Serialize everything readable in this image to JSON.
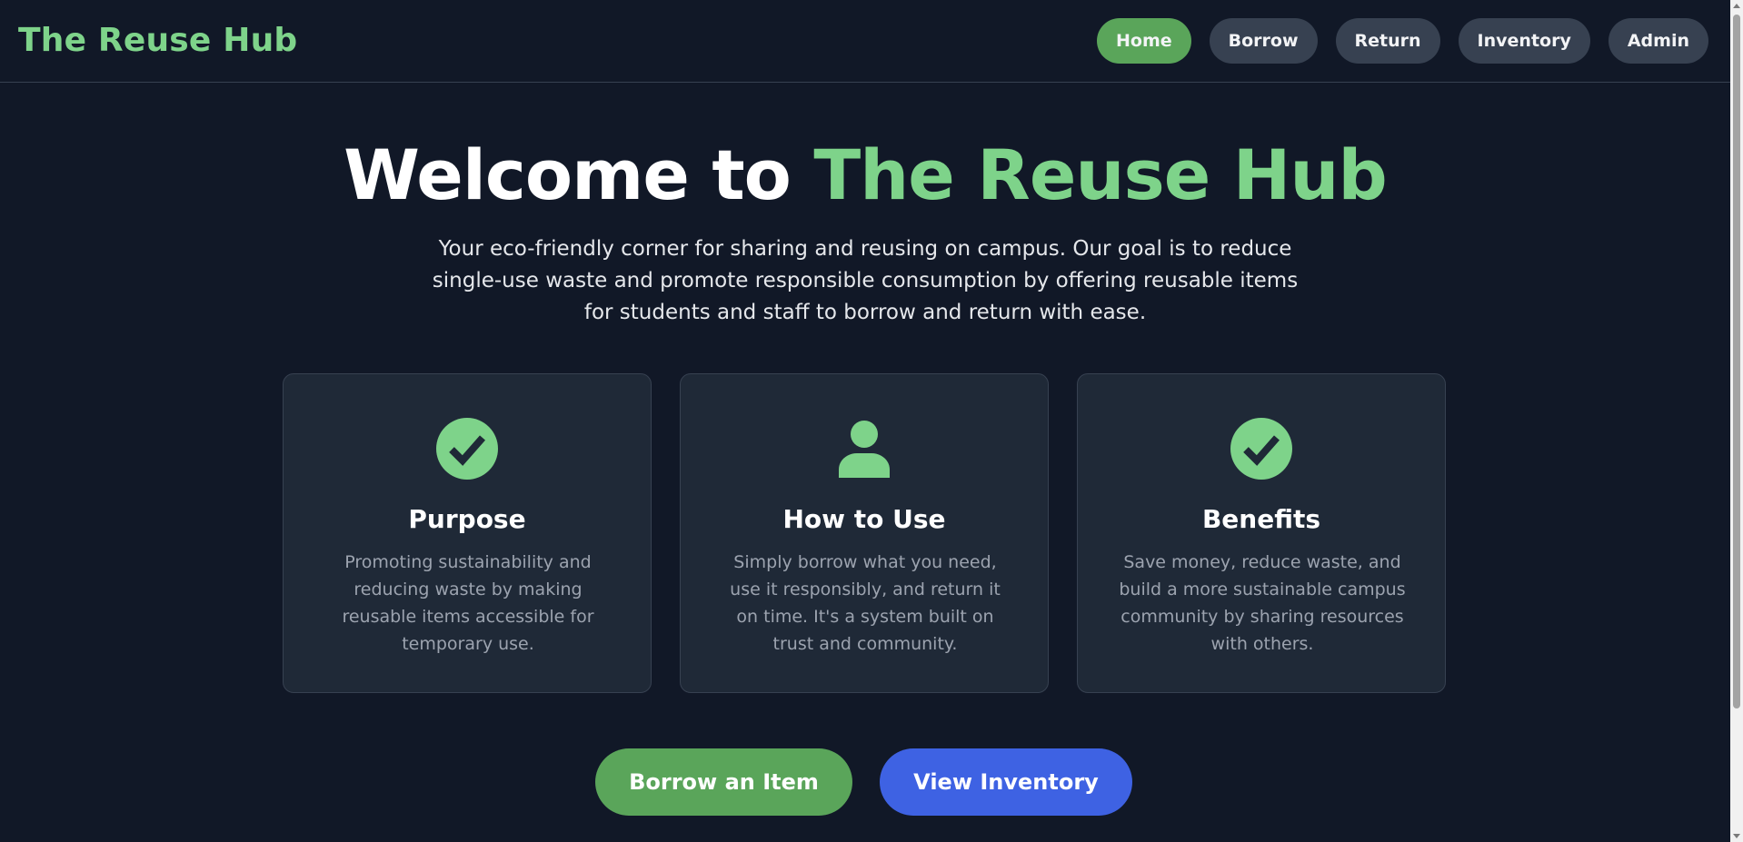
{
  "header": {
    "brand": "The Reuse Hub",
    "nav": [
      {
        "label": "Home",
        "active": true
      },
      {
        "label": "Borrow",
        "active": false
      },
      {
        "label": "Return",
        "active": false
      },
      {
        "label": "Inventory",
        "active": false
      },
      {
        "label": "Admin",
        "active": false
      }
    ]
  },
  "hero": {
    "title_prefix": "Welcome to ",
    "title_accent": "The Reuse Hub",
    "subtitle": "Your eco-friendly corner for sharing and reusing on campus. Our goal is to reduce single-use waste and promote responsible consumption by offering reusable items for students and staff to borrow and return with ease."
  },
  "cards": [
    {
      "icon": "check-circle-icon",
      "title": "Purpose",
      "text": "Promoting sustainability and reducing waste by making reusable items accessible for temporary use."
    },
    {
      "icon": "user-icon",
      "title": "How to Use",
      "text": "Simply borrow what you need, use it responsibly, and return it on time. It's a system built on trust and community."
    },
    {
      "icon": "check-circle-icon",
      "title": "Benefits",
      "text": "Save money, reduce waste, and build a more sustainable campus community by sharing resources with others."
    }
  ],
  "cta": {
    "primary": "Borrow an Item",
    "secondary": "View Inventory"
  },
  "colors": {
    "background": "#111827",
    "card": "#1f2937",
    "accent_green": "#7ed38a",
    "button_green": "#5aa55a",
    "button_blue": "#3e62e3",
    "nav_button": "#374151"
  }
}
